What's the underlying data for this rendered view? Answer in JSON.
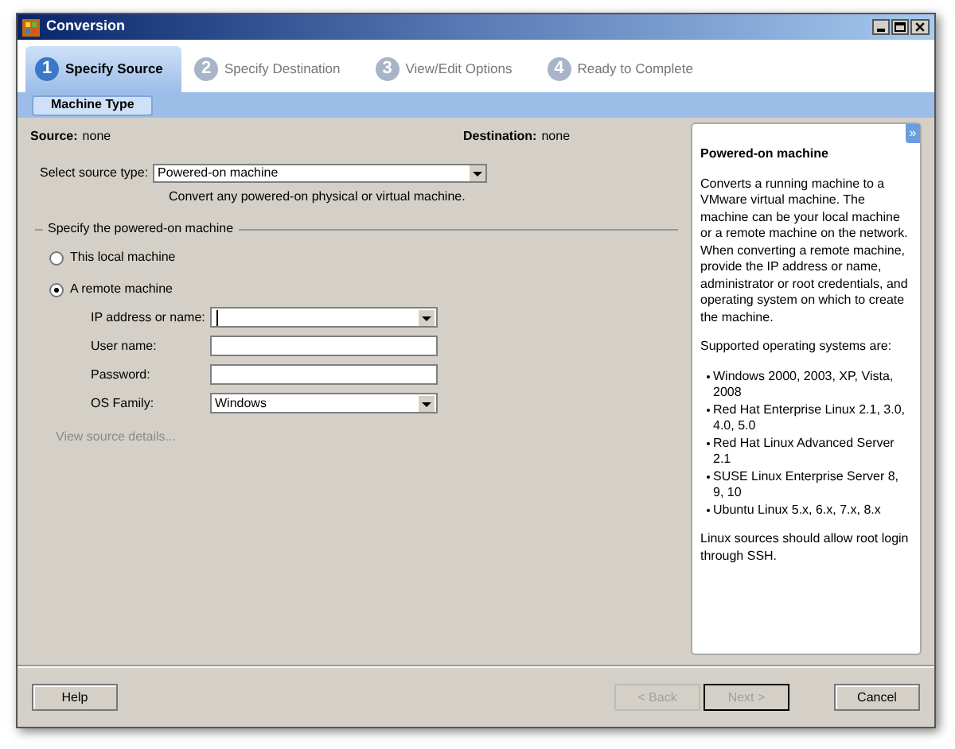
{
  "window": {
    "title": "Conversion"
  },
  "steps": [
    {
      "number": "1",
      "label": "Specify Source",
      "selected": true
    },
    {
      "number": "2",
      "label": "Specify Destination",
      "selected": false
    },
    {
      "number": "3",
      "label": "View/Edit Options",
      "selected": false
    },
    {
      "number": "4",
      "label": "Ready to Complete",
      "selected": false
    }
  ],
  "subtabs": [
    {
      "label": "Machine Type",
      "selected": true
    }
  ],
  "summary": [
    {
      "label": "Source:",
      "value": "none"
    },
    {
      "label": "Destination:",
      "value": "none"
    }
  ],
  "source_type": {
    "label": "Select source type:",
    "value": "Powered-on machine",
    "description": "Convert any powered-on physical or virtual machine."
  },
  "group": {
    "title": "Specify the powered-on machine",
    "options": [
      {
        "label": "This local machine",
        "selected": false
      },
      {
        "label": "A remote machine",
        "selected": true
      }
    ],
    "fields": [
      {
        "kind": "combo",
        "label": "IP address or name:",
        "focused": true
      },
      {
        "kind": "text",
        "label": "User name:",
        "focused": false
      },
      {
        "kind": "text",
        "label": "Password:",
        "focused": false
      },
      {
        "kind": "combo",
        "label": "OS Family:",
        "value": "Windows",
        "focused": false
      }
    ]
  },
  "details_link": {
    "label": "View source details...",
    "disabled": true
  },
  "help_panel": {
    "collapse": "»",
    "title": "Powered-on machine",
    "paragraphs": [
      "Converts a running machine to a VMware virtual machine. The machine can be your local machine or a remote machine on the network. When converting a remote machine, provide the IP address or name, administrator or root credentials, and operating system on which to create the machine.",
      "Supported operating systems are:"
    ],
    "list": [
      "Windows 2000, 2003, XP, Vista, 2008",
      "Red Hat Enterprise Linux 2.1, 3.0, 4.0, 5.0",
      "Red Hat Linux Advanced Server 2.1",
      "SUSE Linux Enterprise Server 8, 9, 10",
      "Ubuntu Linux 5.x, 6.x, 7.x, 8.x"
    ],
    "footer": "Linux sources should allow root login through SSH."
  },
  "buttons": [
    {
      "kind": "help",
      "label": "Help",
      "disabled": false
    },
    {
      "kind": "nav",
      "label": "< Back",
      "disabled": true
    },
    {
      "kind": "nav",
      "label": "Next >",
      "disabled": true
    },
    {
      "kind": "cancel",
      "label": "Cancel",
      "disabled": false
    }
  ]
}
